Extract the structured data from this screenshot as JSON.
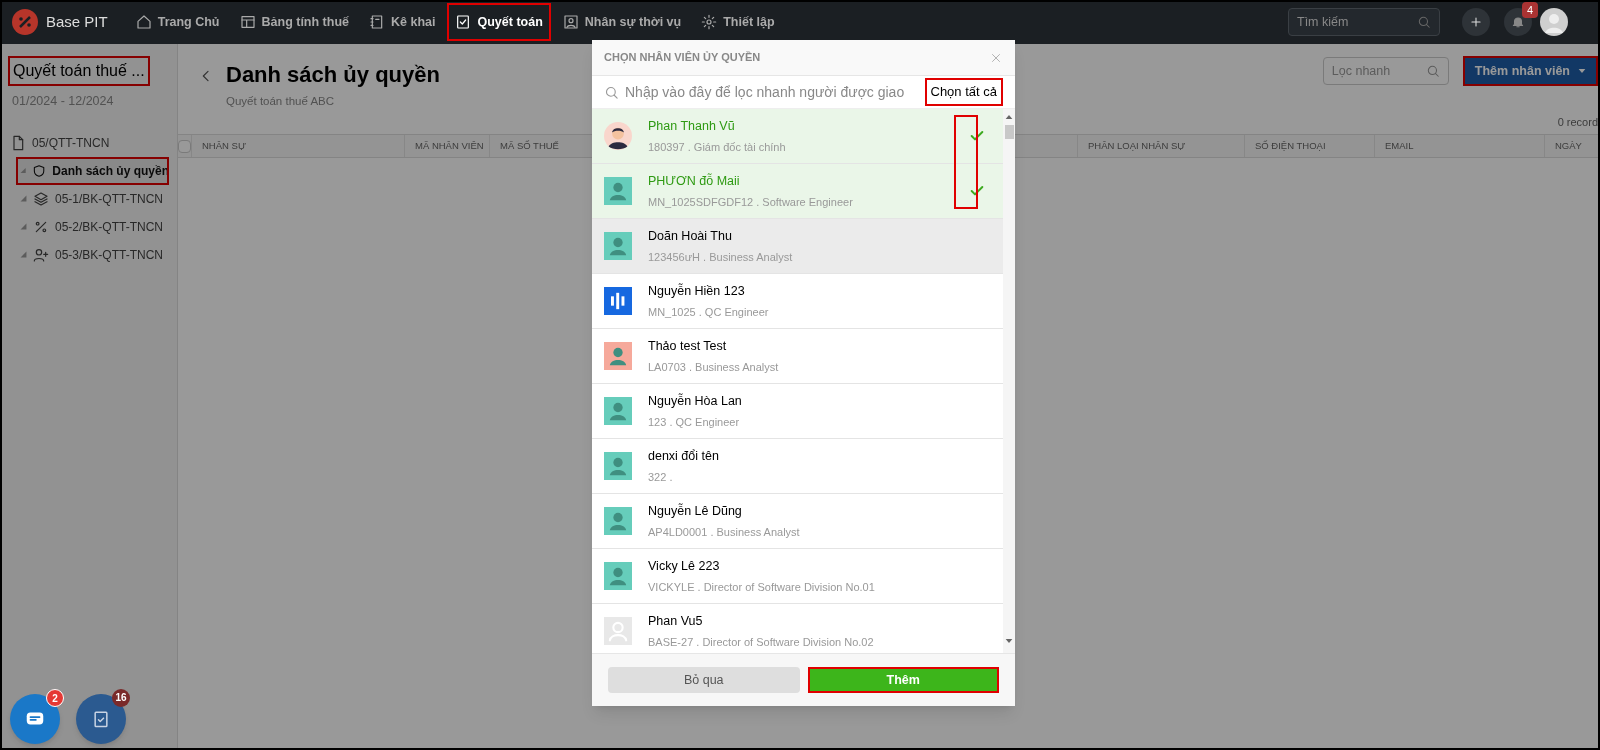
{
  "topbar": {
    "brand": "Base PIT",
    "nav": [
      {
        "label": "Trang Chủ",
        "selected": false,
        "highlighted": false
      },
      {
        "label": "Bảng tính thuế",
        "selected": false,
        "highlighted": false
      },
      {
        "label": "Kê khai",
        "selected": false,
        "highlighted": false
      },
      {
        "label": "Quyết toán",
        "selected": true,
        "highlighted": true
      },
      {
        "label": "Nhân sự thời vụ",
        "selected": false,
        "highlighted": false
      },
      {
        "label": "Thiết lập",
        "selected": false,
        "highlighted": false
      }
    ],
    "search_placeholder": "Tìm kiếm",
    "notification_count": "4"
  },
  "sidebar": {
    "title": "Quyết toán thuế ...",
    "title_highlighted": true,
    "period": "01/2024 - 12/2024",
    "tree": [
      {
        "label": "05/QTT-TNCN",
        "selected": false,
        "highlighted": false,
        "children": [
          {
            "label": "Danh sách ủy quyền",
            "selected": true,
            "highlighted": true
          },
          {
            "label": "05-1/BK-QTT-TNCN",
            "selected": false,
            "highlighted": false
          },
          {
            "label": "05-2/BK-QTT-TNCN",
            "selected": false,
            "highlighted": false
          },
          {
            "label": "05-3/BK-QTT-TNCN",
            "selected": false,
            "highlighted": false
          }
        ]
      }
    ]
  },
  "page": {
    "title": "Danh sách ủy quyền",
    "subtitle": "Quyết toán thuế ABC",
    "filter_placeholder": "Lọc nhanh",
    "add_button": {
      "label": "Thêm nhân viên",
      "highlighted": true
    },
    "record_count": "0 record",
    "all_checked": false,
    "columns": [
      "NHÂN SỰ",
      "MÃ NHÂN VIÊN",
      "MÃ SỐ THUẾ",
      "PHÂN LOẠI NHÂN SỰ",
      "SỐ ĐIỆN THOẠI",
      "EMAIL",
      "NGÀY"
    ]
  },
  "modal": {
    "title": "CHỌN NHÂN VIÊN ỦY QUYỀN",
    "search_placeholder": "Nhập vào đây để lọc nhanh người được giao",
    "select_all": {
      "label": "Chọn tất cả",
      "highlighted": true
    },
    "checks_highlighted": true,
    "employees": [
      {
        "name": "Phan Thanh Vũ",
        "detail": "180397 . Giám đốc tài chính",
        "kind": "photo",
        "selected": true,
        "hovered": false
      },
      {
        "name": "PHƯƠN đỗ Maii",
        "detail": "MN_1025SDFGDF12 . Software Engineer",
        "kind": "person",
        "color": "#66cdbb",
        "selected": true,
        "hovered": false
      },
      {
        "name": "Doãn Hoài Thu",
        "detail": "123456ưH . Business Analyst",
        "kind": "person",
        "color": "#66cdbb",
        "selected": false,
        "hovered": true
      },
      {
        "name": "Nguyễn Hiền 123",
        "detail": "MN_1025 . QC Engineer",
        "kind": "logo",
        "selected": false,
        "hovered": false
      },
      {
        "name": "Thảo test Test",
        "detail": "LA0703 . Business Analyst",
        "kind": "person",
        "color": "#f6a99b",
        "selected": false,
        "hovered": false
      },
      {
        "name": "Nguyễn Hòa Lan",
        "detail": "123 . QC Engineer",
        "kind": "person",
        "color": "#66cdbb",
        "selected": false,
        "hovered": false
      },
      {
        "name": "denxi đổi tên",
        "detail": "322 .",
        "kind": "person",
        "color": "#66cdbb",
        "selected": false,
        "hovered": false
      },
      {
        "name": "Nguyễn Lê Dũng",
        "detail": "AP4LD0001 . Business Analyst",
        "kind": "person",
        "color": "#66cdbb",
        "selected": false,
        "hovered": false
      },
      {
        "name": "Vicky Lê 223",
        "detail": "VICKYLE . Director of Software Division No.01",
        "kind": "person",
        "color": "#66cdbb",
        "selected": false,
        "hovered": false
      },
      {
        "name": "Phan Vu5",
        "detail": "BASE-27 . Director of Software Division No.02",
        "kind": "blank",
        "selected": false,
        "hovered": false
      }
    ],
    "cancel_label": "Bỏ qua",
    "confirm": {
      "label": "Thêm",
      "highlighted": true
    }
  },
  "floating": [
    {
      "kind": "chat",
      "badge": "2"
    },
    {
      "kind": "tasks",
      "badge": "16"
    }
  ]
}
